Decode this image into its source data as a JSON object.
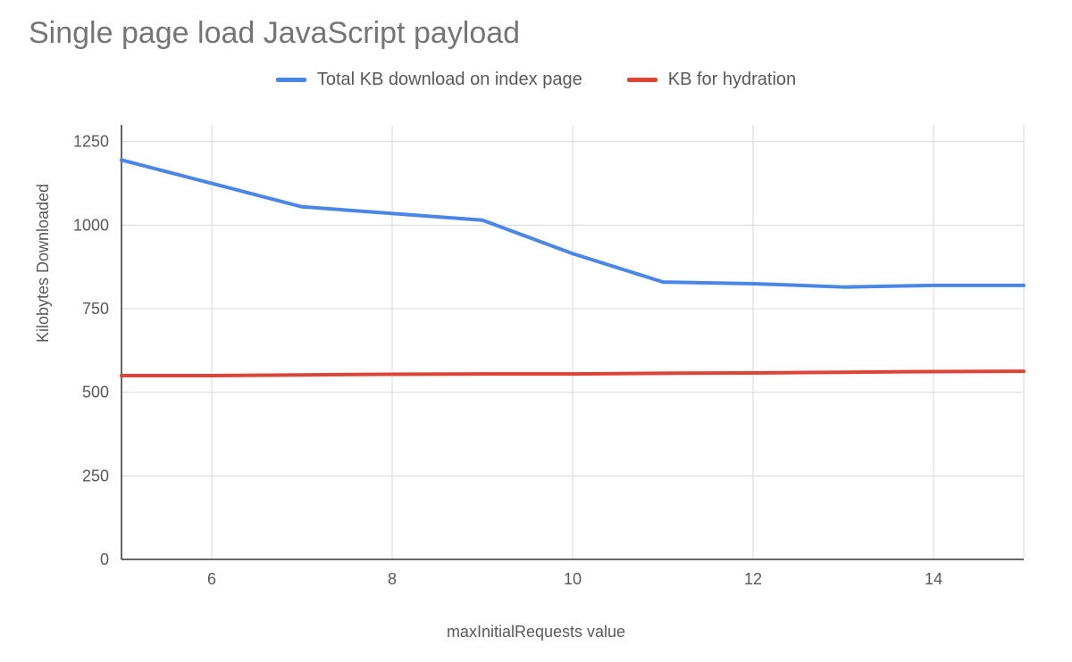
{
  "chart_data": {
    "type": "line",
    "title": "Single page load JavaScript payload",
    "xlabel": "maxInitialRequests value",
    "ylabel": "Kilobytes Downloaded",
    "x": [
      5,
      6,
      7,
      8,
      9,
      10,
      11,
      12,
      13,
      14,
      15
    ],
    "x_ticks": [
      6,
      8,
      10,
      12,
      14
    ],
    "y_ticks": [
      0,
      250,
      500,
      750,
      1000,
      1250
    ],
    "ylim": [
      0,
      1300
    ],
    "xlim": [
      5,
      15
    ],
    "series": [
      {
        "name": "Total KB download on index page",
        "color": "#4a86e8",
        "values": [
          1195,
          1125,
          1055,
          1035,
          1015,
          915,
          830,
          825,
          815,
          820,
          820
        ]
      },
      {
        "name": "KB for hydration",
        "color": "#db4437",
        "values": [
          550,
          550,
          552,
          554,
          555,
          555,
          557,
          558,
          560,
          562,
          563
        ]
      }
    ],
    "legend_position": "top",
    "grid": true
  }
}
